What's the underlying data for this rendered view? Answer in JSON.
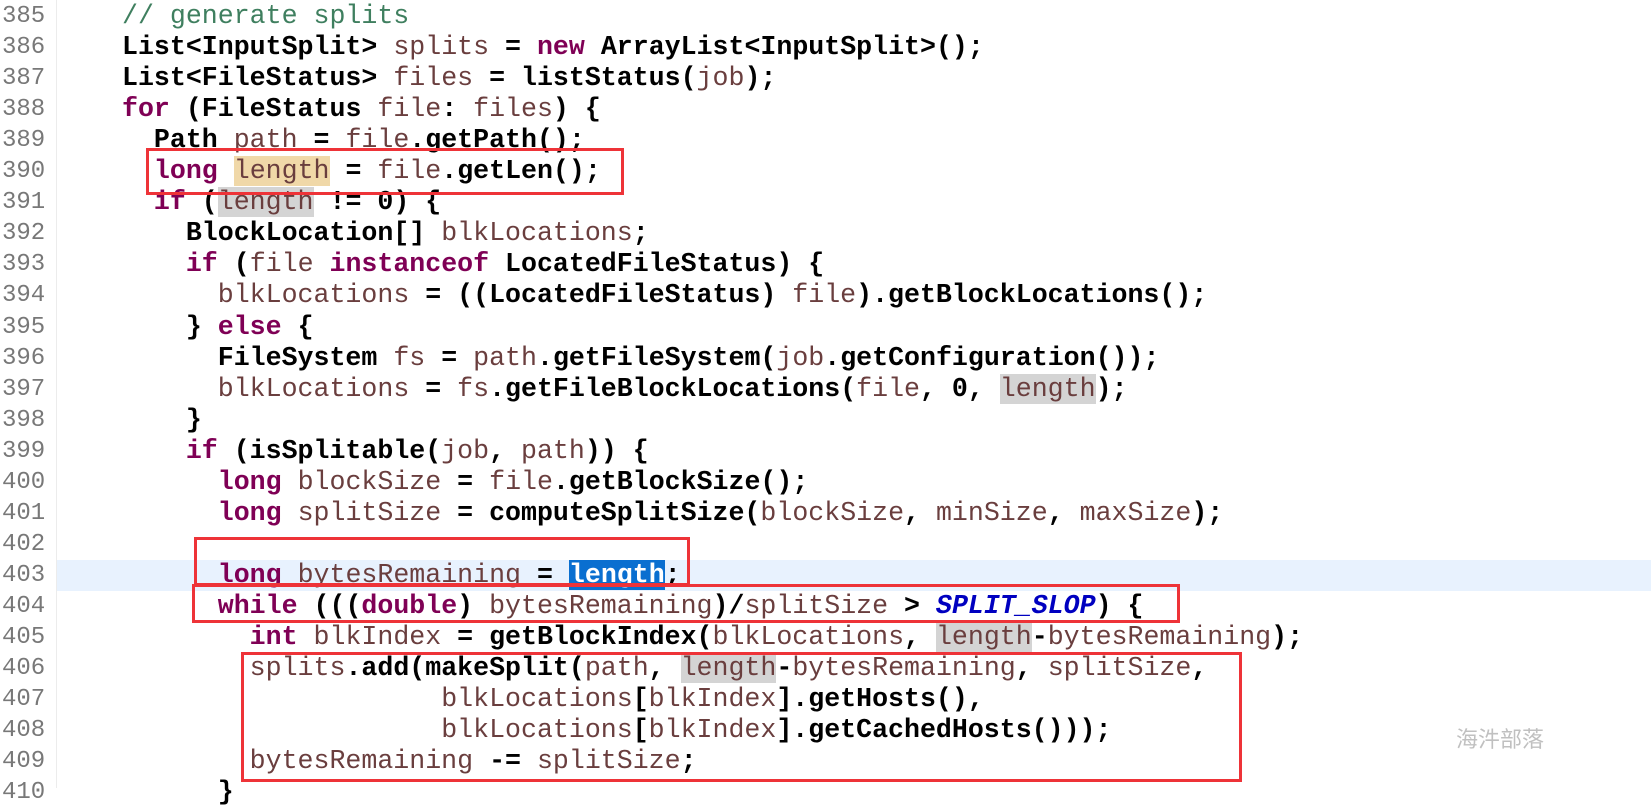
{
  "editor": {
    "accent_colors": {
      "keyword": "#7f0055",
      "comment": "#3f7f5f",
      "variable": "#6a3e3e",
      "constant": "#0000c0",
      "annotation_box": "#ee3338",
      "current_line": "#e8f2fe",
      "selection": "#0a6fd0"
    },
    "lines": [
      {
        "num": "385",
        "indent": "",
        "tokens": [
          {
            "t": "// generate splits",
            "c": "cm"
          }
        ]
      },
      {
        "num": "386",
        "indent": "",
        "tokens": [
          {
            "t": "List<InputSplit> ",
            "c": ""
          },
          {
            "t": "splits",
            "c": "var"
          },
          {
            "t": " = ",
            "c": ""
          },
          {
            "t": "new",
            "c": "kw"
          },
          {
            "t": " ArrayList<InputSplit>();",
            "c": ""
          }
        ]
      },
      {
        "num": "387",
        "indent": "",
        "tokens": [
          {
            "t": "List<FileStatus> ",
            "c": ""
          },
          {
            "t": "files",
            "c": "var"
          },
          {
            "t": " = listStatus(",
            "c": ""
          },
          {
            "t": "job",
            "c": "var"
          },
          {
            "t": ");",
            "c": ""
          }
        ]
      },
      {
        "num": "388",
        "indent": "",
        "tokens": [
          {
            "t": "for",
            "c": "kw"
          },
          {
            "t": " (FileStatus ",
            "c": ""
          },
          {
            "t": "file",
            "c": "var"
          },
          {
            "t": ": ",
            "c": ""
          },
          {
            "t": "files",
            "c": "var"
          },
          {
            "t": ") {",
            "c": ""
          }
        ]
      },
      {
        "num": "389",
        "indent": "  ",
        "tokens": [
          {
            "t": "Path ",
            "c": ""
          },
          {
            "t": "path",
            "c": "var"
          },
          {
            "t": " = ",
            "c": ""
          },
          {
            "t": "file",
            "c": "var"
          },
          {
            "t": ".getPath();",
            "c": ""
          }
        ]
      },
      {
        "num": "390",
        "indent": "  ",
        "tokens": [
          {
            "t": "long",
            "c": "kw"
          },
          {
            "t": " ",
            "c": ""
          },
          {
            "t": "length",
            "c": "var hl-write"
          },
          {
            "t": " = ",
            "c": ""
          },
          {
            "t": "file",
            "c": "var"
          },
          {
            "t": ".getLen();",
            "c": ""
          }
        ]
      },
      {
        "num": "391",
        "indent": "  ",
        "tokens": [
          {
            "t": "if",
            "c": "kw"
          },
          {
            "t": " (",
            "c": ""
          },
          {
            "t": "length",
            "c": "var hl-read"
          },
          {
            "t": " != 0) {",
            "c": ""
          }
        ]
      },
      {
        "num": "392",
        "indent": "    ",
        "tokens": [
          {
            "t": "BlockLocation[] ",
            "c": ""
          },
          {
            "t": "blkLocations",
            "c": "var"
          },
          {
            "t": ";",
            "c": ""
          }
        ]
      },
      {
        "num": "393",
        "indent": "    ",
        "tokens": [
          {
            "t": "if",
            "c": "kw"
          },
          {
            "t": " (",
            "c": ""
          },
          {
            "t": "file",
            "c": "var"
          },
          {
            "t": " ",
            "c": ""
          },
          {
            "t": "instanceof",
            "c": "kw"
          },
          {
            "t": " LocatedFileStatus) {",
            "c": ""
          }
        ]
      },
      {
        "num": "394",
        "indent": "      ",
        "tokens": [
          {
            "t": "blkLocations",
            "c": "var"
          },
          {
            "t": " = ((LocatedFileStatus) ",
            "c": ""
          },
          {
            "t": "file",
            "c": "var"
          },
          {
            "t": ").getBlockLocations();",
            "c": ""
          }
        ]
      },
      {
        "num": "395",
        "indent": "    ",
        "tokens": [
          {
            "t": "} ",
            "c": ""
          },
          {
            "t": "else",
            "c": "kw"
          },
          {
            "t": " {",
            "c": ""
          }
        ]
      },
      {
        "num": "396",
        "indent": "      ",
        "tokens": [
          {
            "t": "FileSystem ",
            "c": ""
          },
          {
            "t": "fs",
            "c": "var"
          },
          {
            "t": " = ",
            "c": ""
          },
          {
            "t": "path",
            "c": "var"
          },
          {
            "t": ".getFileSystem(",
            "c": ""
          },
          {
            "t": "job",
            "c": "var"
          },
          {
            "t": ".getConfiguration());",
            "c": ""
          }
        ]
      },
      {
        "num": "397",
        "indent": "      ",
        "tokens": [
          {
            "t": "blkLocations",
            "c": "var"
          },
          {
            "t": " = ",
            "c": ""
          },
          {
            "t": "fs",
            "c": "var"
          },
          {
            "t": ".getFileBlockLocations(",
            "c": ""
          },
          {
            "t": "file",
            "c": "var"
          },
          {
            "t": ", 0, ",
            "c": ""
          },
          {
            "t": "length",
            "c": "var hl-read"
          },
          {
            "t": ");",
            "c": ""
          }
        ]
      },
      {
        "num": "398",
        "indent": "    ",
        "tokens": [
          {
            "t": "}",
            "c": ""
          }
        ]
      },
      {
        "num": "399",
        "indent": "    ",
        "tokens": [
          {
            "t": "if",
            "c": "kw"
          },
          {
            "t": " (isSplitable(",
            "c": ""
          },
          {
            "t": "job",
            "c": "var"
          },
          {
            "t": ", ",
            "c": ""
          },
          {
            "t": "path",
            "c": "var"
          },
          {
            "t": ")) {",
            "c": ""
          }
        ]
      },
      {
        "num": "400",
        "indent": "      ",
        "tokens": [
          {
            "t": "long",
            "c": "kw"
          },
          {
            "t": " ",
            "c": ""
          },
          {
            "t": "blockSize",
            "c": "var"
          },
          {
            "t": " = ",
            "c": ""
          },
          {
            "t": "file",
            "c": "var"
          },
          {
            "t": ".getBlockSize();",
            "c": ""
          }
        ]
      },
      {
        "num": "401",
        "indent": "      ",
        "tokens": [
          {
            "t": "long",
            "c": "kw"
          },
          {
            "t": " ",
            "c": ""
          },
          {
            "t": "splitSize",
            "c": "var"
          },
          {
            "t": " = computeSplitSize(",
            "c": ""
          },
          {
            "t": "blockSize",
            "c": "var"
          },
          {
            "t": ", ",
            "c": ""
          },
          {
            "t": "minSize",
            "c": "var"
          },
          {
            "t": ", ",
            "c": ""
          },
          {
            "t": "maxSize",
            "c": "var"
          },
          {
            "t": ");",
            "c": ""
          }
        ]
      },
      {
        "num": "402",
        "indent": "",
        "tokens": []
      },
      {
        "num": "403",
        "indent": "      ",
        "current": true,
        "tokens": [
          {
            "t": "long",
            "c": "kw"
          },
          {
            "t": " ",
            "c": ""
          },
          {
            "t": "bytesRemaining",
            "c": "var"
          },
          {
            "t": " = ",
            "c": ""
          },
          {
            "t": "length",
            "c": "hl-sel"
          },
          {
            "t": ";",
            "c": ""
          }
        ]
      },
      {
        "num": "404",
        "indent": "      ",
        "tokens": [
          {
            "t": "while",
            "c": "kw"
          },
          {
            "t": " (((",
            "c": ""
          },
          {
            "t": "double",
            "c": "kw"
          },
          {
            "t": ") ",
            "c": ""
          },
          {
            "t": "bytesRemaining",
            "c": "var"
          },
          {
            "t": ")/",
            "c": ""
          },
          {
            "t": "splitSize",
            "c": "var"
          },
          {
            "t": " > ",
            "c": ""
          },
          {
            "t": "SPLIT_SLOP",
            "c": "cst"
          },
          {
            "t": ") {",
            "c": ""
          }
        ]
      },
      {
        "num": "405",
        "indent": "        ",
        "tokens": [
          {
            "t": "int",
            "c": "kw"
          },
          {
            "t": " ",
            "c": ""
          },
          {
            "t": "blkIndex",
            "c": "var"
          },
          {
            "t": " = getBlockIndex(",
            "c": ""
          },
          {
            "t": "blkLocations",
            "c": "var"
          },
          {
            "t": ", ",
            "c": ""
          },
          {
            "t": "length",
            "c": "var hl-read"
          },
          {
            "t": "-",
            "c": ""
          },
          {
            "t": "bytesRemaining",
            "c": "var"
          },
          {
            "t": ");",
            "c": ""
          }
        ]
      },
      {
        "num": "406",
        "indent": "        ",
        "tokens": [
          {
            "t": "splits",
            "c": "var"
          },
          {
            "t": ".add(makeSplit(",
            "c": ""
          },
          {
            "t": "path",
            "c": "var"
          },
          {
            "t": ", ",
            "c": ""
          },
          {
            "t": "length",
            "c": "var hl-read"
          },
          {
            "t": "-",
            "c": ""
          },
          {
            "t": "bytesRemaining",
            "c": "var"
          },
          {
            "t": ", ",
            "c": ""
          },
          {
            "t": "splitSize",
            "c": "var"
          },
          {
            "t": ",",
            "c": ""
          }
        ]
      },
      {
        "num": "407",
        "indent": "                    ",
        "tokens": [
          {
            "t": "blkLocations",
            "c": "var"
          },
          {
            "t": "[",
            "c": ""
          },
          {
            "t": "blkIndex",
            "c": "var"
          },
          {
            "t": "].getHosts(),",
            "c": ""
          }
        ]
      },
      {
        "num": "408",
        "indent": "                    ",
        "tokens": [
          {
            "t": "blkLocations",
            "c": "var"
          },
          {
            "t": "[",
            "c": ""
          },
          {
            "t": "blkIndex",
            "c": "var"
          },
          {
            "t": "].getCachedHosts()));",
            "c": ""
          }
        ]
      },
      {
        "num": "409",
        "indent": "        ",
        "tokens": [
          {
            "t": "bytesRemaining",
            "c": "var"
          },
          {
            "t": " -= ",
            "c": ""
          },
          {
            "t": "splitSize",
            "c": "var"
          },
          {
            "t": ";",
            "c": ""
          }
        ]
      },
      {
        "num": "410",
        "indent": "      ",
        "tokens": [
          {
            "t": "}",
            "c": ""
          }
        ]
      }
    ]
  },
  "watermark": "海汼部落"
}
